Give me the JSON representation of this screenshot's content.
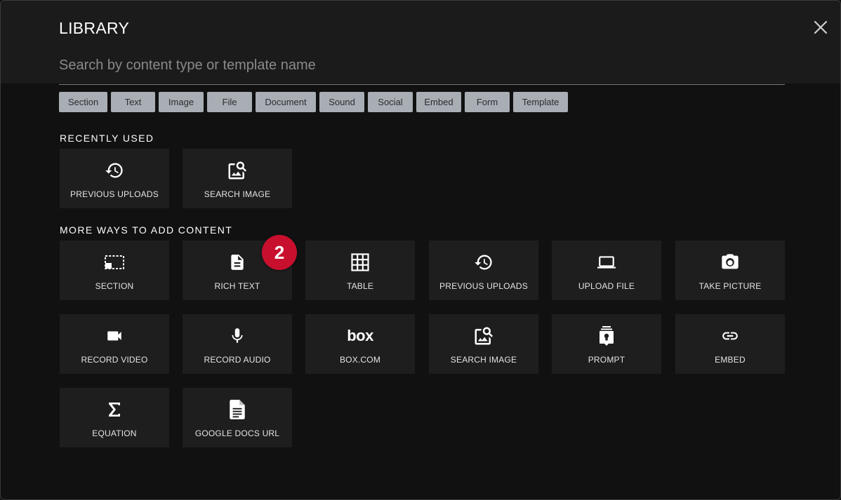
{
  "modal": {
    "title": "LIBRARY",
    "close_icon": "close-icon"
  },
  "search": {
    "placeholder": "Search by content type or template name",
    "value": ""
  },
  "filters": [
    "Section",
    "Text",
    "Image",
    "File",
    "Document",
    "Sound",
    "Social",
    "Embed",
    "Form",
    "Template"
  ],
  "recently_used": {
    "heading": "RECENTLY USED",
    "items": [
      {
        "label": "PREVIOUS UPLOADS",
        "icon": "history-icon"
      },
      {
        "label": "SEARCH IMAGE",
        "icon": "image-search-icon"
      }
    ]
  },
  "more_ways": {
    "heading": "MORE WAYS TO ADD CONTENT",
    "items": [
      {
        "label": "SECTION",
        "icon": "section-icon"
      },
      {
        "label": "RICH TEXT",
        "icon": "document-icon"
      },
      {
        "label": "TABLE",
        "icon": "table-icon"
      },
      {
        "label": "PREVIOUS UPLOADS",
        "icon": "history-icon"
      },
      {
        "label": "UPLOAD FILE",
        "icon": "laptop-icon"
      },
      {
        "label": "TAKE PICTURE",
        "icon": "camera-icon"
      },
      {
        "label": "RECORD VIDEO",
        "icon": "video-camera-icon"
      },
      {
        "label": "RECORD AUDIO",
        "icon": "microphone-icon"
      },
      {
        "label": "BOX.COM",
        "icon": "box-logo-icon",
        "logo_text": "box"
      },
      {
        "label": "SEARCH IMAGE",
        "icon": "image-search-icon"
      },
      {
        "label": "PROMPT",
        "icon": "prompt-icon"
      },
      {
        "label": "EMBED",
        "icon": "link-icon"
      },
      {
        "label": "EQUATION",
        "icon": "sigma-icon"
      },
      {
        "label": "GOOGLE DOCS URL",
        "icon": "google-doc-icon"
      }
    ]
  },
  "step_badge": "2",
  "colors": {
    "background": "#111111",
    "header": "#1b1b1c",
    "tile": "#1e1e1f",
    "chip": "#a9aeb5",
    "badge": "#c8102e"
  }
}
